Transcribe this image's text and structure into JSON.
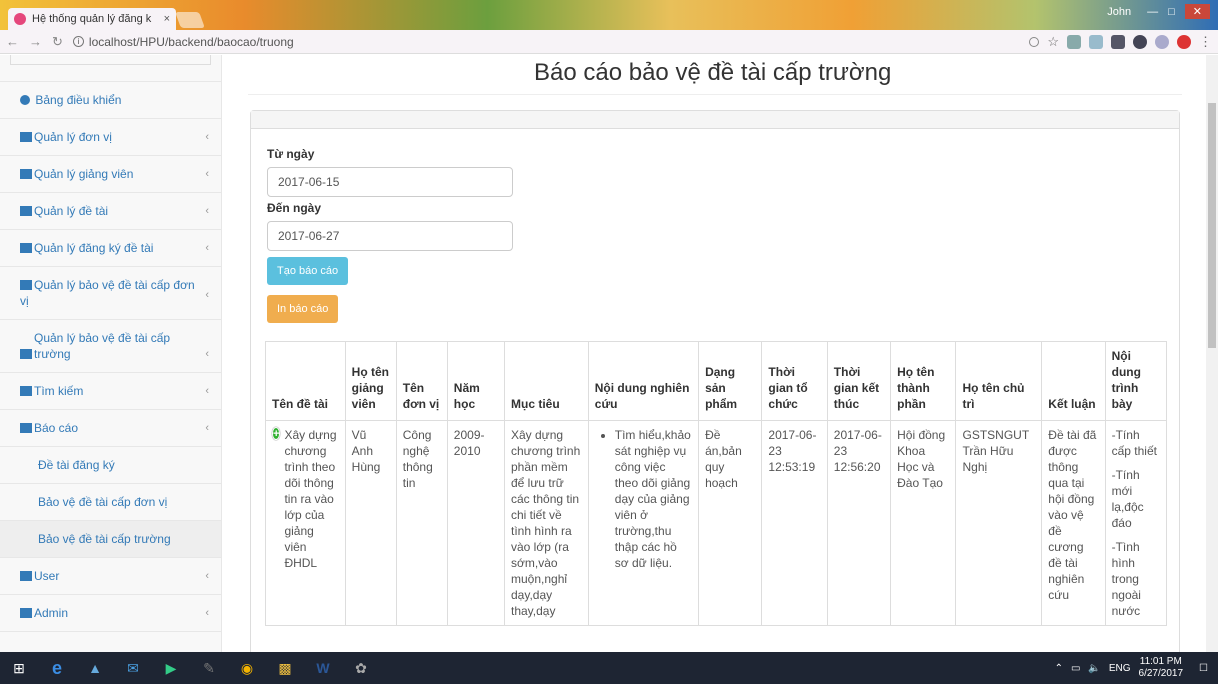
{
  "browser": {
    "tab_title": "Hệ thống quản lý đăng k",
    "tab_close": "×",
    "user_label": "John",
    "url": "localhost/HPU/backend/baocao/truong"
  },
  "sidebar": {
    "items": [
      {
        "label": "Bảng điều khiển",
        "chevron": ""
      },
      {
        "label": "Quản lý đơn vị",
        "chevron": "‹"
      },
      {
        "label": "Quản lý giảng viên",
        "chevron": "‹"
      },
      {
        "label": "Quản lý đề tài",
        "chevron": "‹"
      },
      {
        "label": "Quản lý đăng ký đề tài",
        "chevron": "‹"
      },
      {
        "label": "Quản lý bảo vệ đề tài cấp đơn vị",
        "chevron": "‹"
      },
      {
        "label": "Quản lý bảo vệ đề tài cấp trường",
        "chevron": "‹"
      },
      {
        "label": "Tìm kiếm",
        "chevron": "‹"
      },
      {
        "label": "Báo cáo",
        "chevron": "‹"
      }
    ],
    "sub_items": [
      "Đề tài đăng ký",
      "Bảo vệ đề tài cấp đơn vị",
      "Bảo vệ đề tài cấp trường"
    ],
    "bottom_items": [
      {
        "label": "User",
        "chevron": "‹"
      },
      {
        "label": "Admin",
        "chevron": "‹"
      }
    ]
  },
  "main": {
    "title": "Báo cáo bảo vệ đề tài cấp trường",
    "from_label": "Từ ngày",
    "from_value": "2017-06-15",
    "to_label": "Đến ngày",
    "to_value": "2017-06-27",
    "create_button": "Tạo báo cáo",
    "print_button": "In báo cáo"
  },
  "table": {
    "headers": [
      "Tên đề tài",
      "Họ tên giảng viên",
      "Tên đơn vị",
      "Năm học",
      "Mục tiêu",
      "Nội dung nghiên cứu",
      "Dạng sản phẩm",
      "Thời gian tổ chức",
      "Thời gian kết thúc",
      "Họ tên thành phần",
      "Họ tên chủ trì",
      "Kết luận",
      "Nội dung trình bày"
    ],
    "row": {
      "ten_de_tai": "Xây dựng chương trình theo dõi thông tin ra vào lớp của giảng viên ĐHDL",
      "giang_vien": "Vũ Anh Hùng",
      "don_vi": "Công nghệ thông tin",
      "nam_hoc": "2009-2010",
      "muc_tieu": "Xây dựng chương trình phần mềm để lưu trữ các thông tin chi tiết về tình hình ra vào lớp (ra sớm,vào muộn,nghỉ dạy,dạy thay,dạy",
      "noi_dung": "Tìm hiểu,khảo sát nghiệp vụ công việc theo dõi giảng dạy của giảng viên ở trường,thu thập các hồ sơ dữ liệu.",
      "san_pham": "Đề án,bản quy hoạch",
      "tg_to_chuc": "2017-06-23 12:53:19",
      "tg_ket_thuc": "2017-06-23 12:56:20",
      "thanh_phan": "Hội đồng Khoa Học và Đào Tạo",
      "chu_tri": "GSTSNGUT Trần Hữu Nghị",
      "ket_luan": "Đề tài đã được thông qua tại hội đồng vào vệ đề cương đề tài nghiên cứu",
      "trinh_bay_1": "-Tính cấp thiết",
      "trinh_bay_2": "-Tính mới lạ,độc đáo",
      "trinh_bay_3": "-Tình hình trong ngoài nước"
    }
  },
  "taskbar": {
    "lang": "ENG",
    "time": "11:01 PM",
    "date": "6/27/2017"
  }
}
